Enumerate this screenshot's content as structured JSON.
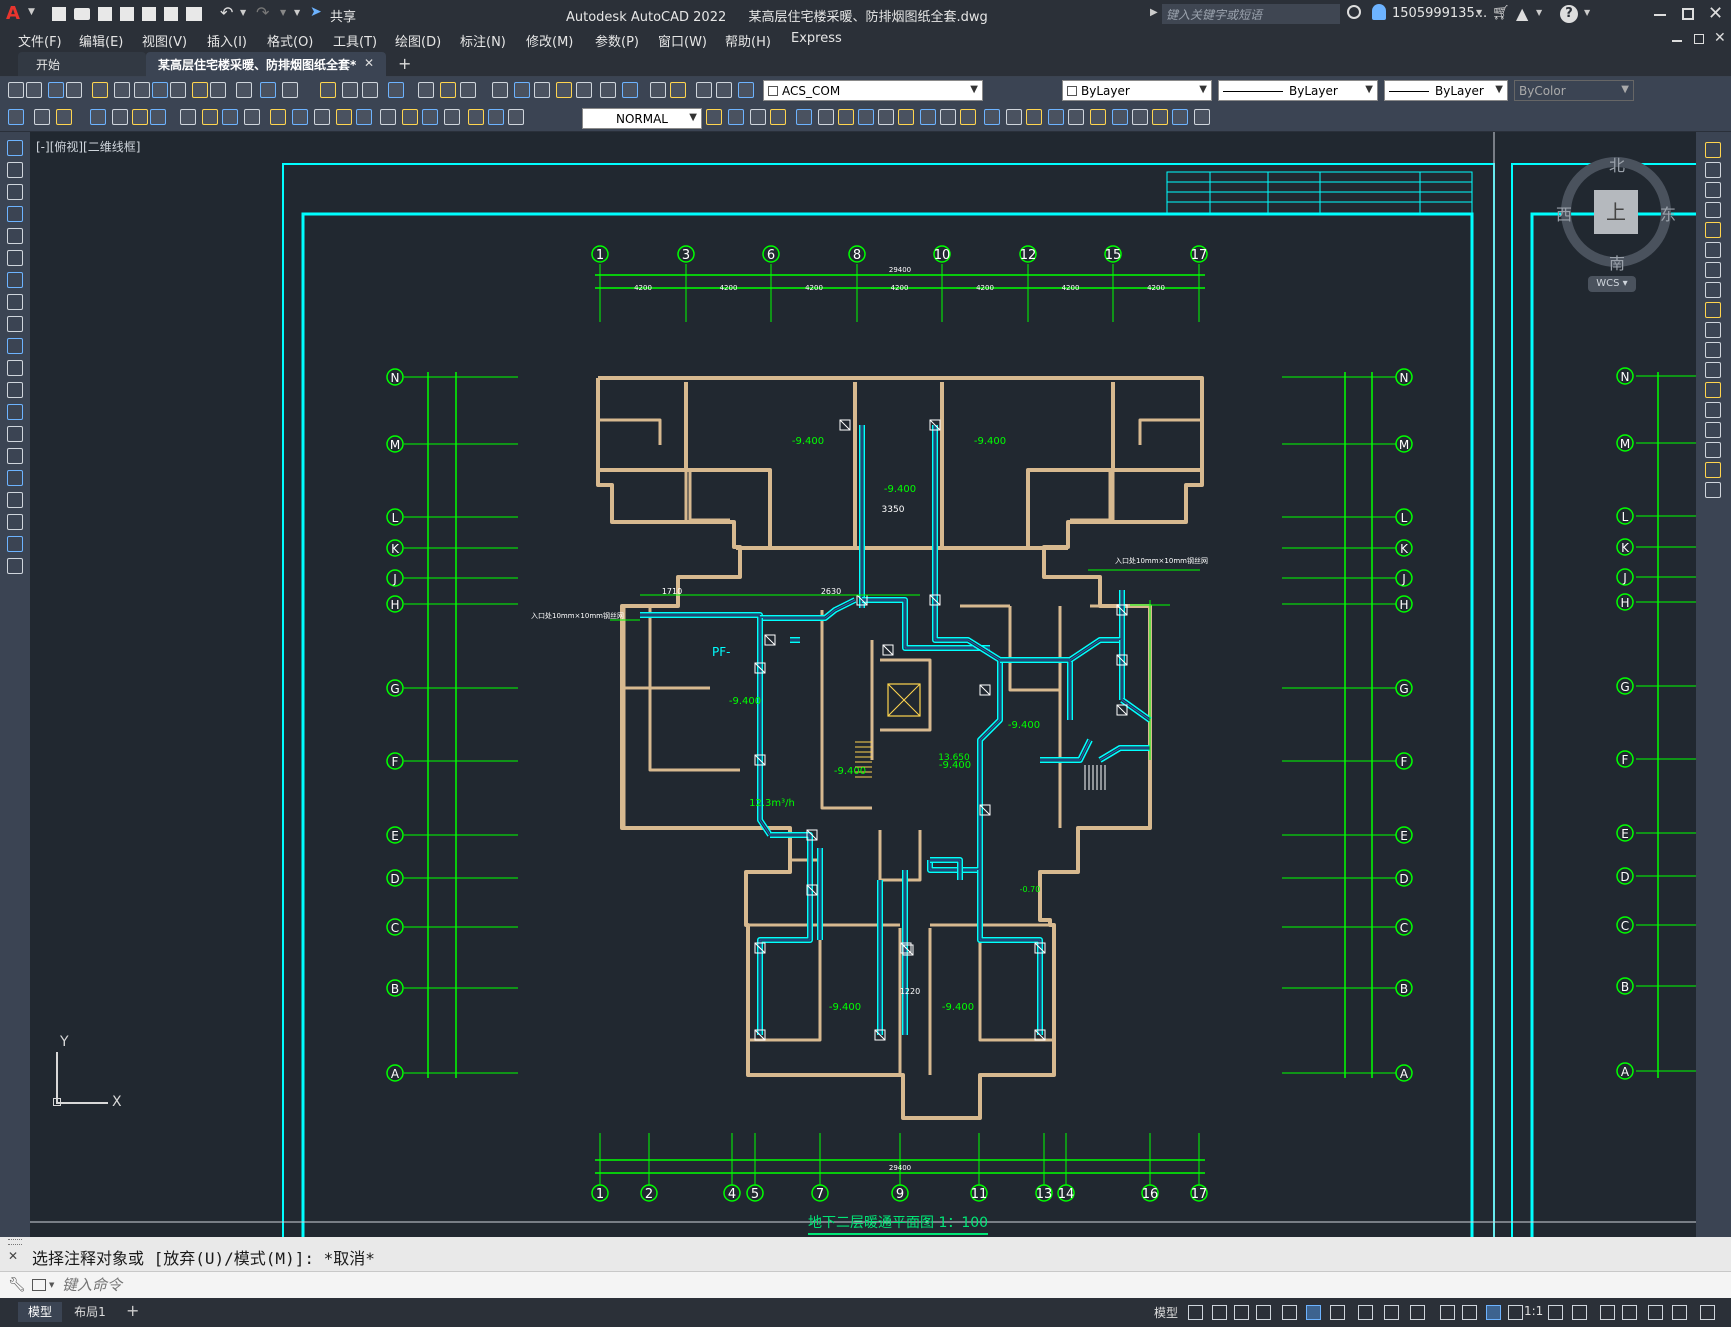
{
  "app": {
    "logo_letter": "A",
    "title": "Autodesk AutoCAD 2022",
    "filename": "某高层住宅楼采暖、防排烟图纸全套.dwg",
    "share_label": "共享",
    "search_placeholder": "键入关键字或短语",
    "user_label": "1505999135...",
    "help_label": "?"
  },
  "menu": [
    "文件(F)",
    "编辑(E)",
    "视图(V)",
    "插入(I)",
    "格式(O)",
    "工具(T)",
    "绘图(D)",
    "标注(N)",
    "修改(M)",
    "参数(P)",
    "窗口(W)",
    "帮助(H)",
    "Express"
  ],
  "tabs": [
    {
      "label": "开始"
    },
    {
      "label": "某高层住宅楼采暖、防排烟图纸全套*"
    }
  ],
  "toolbar": {
    "layer": "ACS_COM",
    "color": "ByLayer",
    "linetype": "ByLayer",
    "lineweight": "ByLayer",
    "plotstyle": "ByColor",
    "dimstyle": "NORMAL"
  },
  "viewport": {
    "label": "[-][俯视][二维线框]",
    "viewcube": {
      "north": "北",
      "south": "南",
      "east": "东",
      "west": "西",
      "face": "上",
      "wcs": "WCS"
    },
    "ucs": {
      "x": "X",
      "y": "Y"
    }
  },
  "drawing": {
    "title": "地下二层暖通平面图 1：100",
    "top_axes": [
      "1",
      "3",
      "6",
      "8",
      "10",
      "12",
      "15",
      "17"
    ],
    "bottom_axes": [
      "1",
      "2",
      "4",
      "5",
      "7",
      "9",
      "11",
      "13",
      "14",
      "16",
      "17"
    ],
    "row_axes": [
      "N",
      "M",
      "L",
      "K",
      "J",
      "H",
      "G",
      "F",
      "E",
      "D",
      "C",
      "B",
      "A"
    ],
    "top_dims": [
      "4200",
      "4200",
      "4200",
      "4200",
      "4200",
      "4200",
      "4200"
    ],
    "top_total": "29400",
    "bottom_total": "29400",
    "annotations": {
      "elev": "-9.400",
      "elev2": "-9.400",
      "dim1": "3350",
      "pf": "PF-",
      "flow": "12.3m³/h",
      "inlet_left": "入口处10mm×10mm钢丝网",
      "inlet_right": "入口处10mm×10mm钢丝网",
      "h_label": "13.650",
      "small1": "2630",
      "small2": "1710",
      "small3": "1220",
      "small4": "-0.70"
    }
  },
  "command": {
    "history": "选择注释对象或 [放弃(U)/模式(M)]: *取消*",
    "placeholder": "键入命令"
  },
  "status": {
    "layout_tabs": [
      "模型",
      "布局1"
    ],
    "model_label": "模型",
    "scale": "1:1"
  },
  "colors": {
    "accent": "#4ab0ff",
    "wall": "#d7b98f",
    "grid": "#00ff00",
    "duct": "#00ffff",
    "frame": "#00ffff",
    "bg": "#212830"
  }
}
